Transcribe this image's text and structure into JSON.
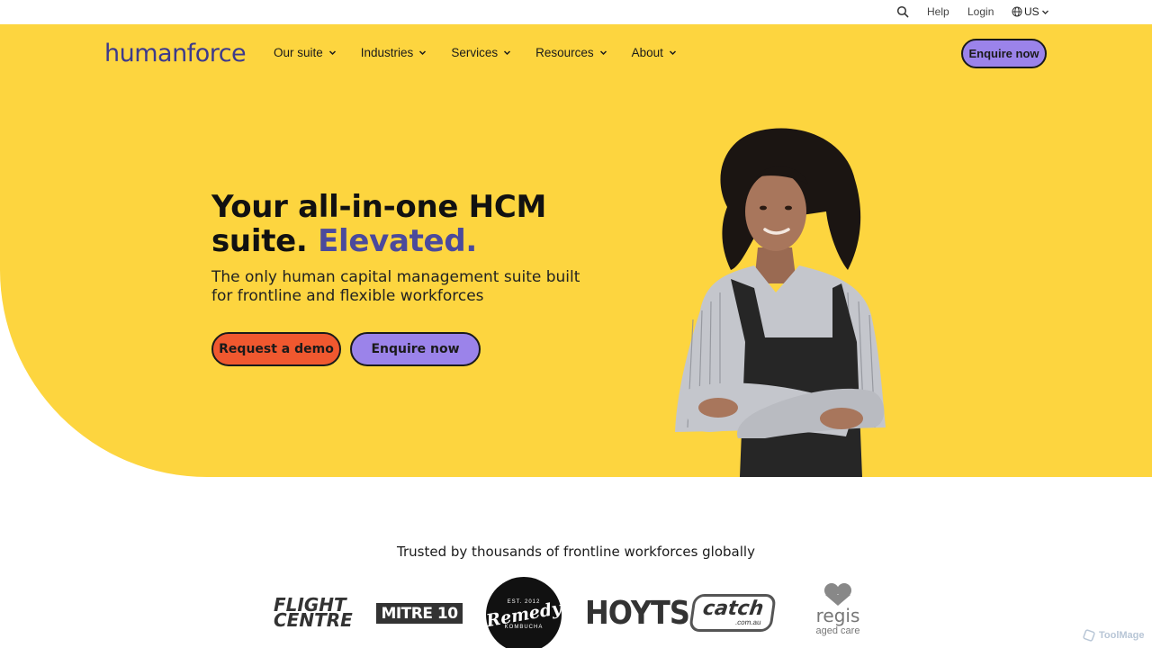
{
  "utility": {
    "help": "Help",
    "login": "Login",
    "locale": "US"
  },
  "header": {
    "logo": "humanforce",
    "nav": [
      {
        "label": "Our suite"
      },
      {
        "label": "Industries"
      },
      {
        "label": "Services"
      },
      {
        "label": "Resources"
      },
      {
        "label": "About"
      }
    ],
    "cta": "Enquire now"
  },
  "hero": {
    "headline_line1": "Your all-in-one HCM",
    "headline_line2_plain": "suite. ",
    "headline_line2_accent": "Elevated.",
    "subhead": "The only human capital management suite built for frontline and flexible workforces",
    "primary_button": "Request a demo",
    "secondary_button": "Enquire now"
  },
  "trusted": {
    "heading": "Trusted by thousands of frontline workforces globally",
    "logos": [
      {
        "name": "flight-centre",
        "line1": "FLIGHT",
        "line2": "CENTRE"
      },
      {
        "name": "mitre-10",
        "text": "MITRE 10"
      },
      {
        "name": "remedy-kombucha",
        "text": "Remedy",
        "sub": "KOMBUCHA",
        "top": "EST. 2012"
      },
      {
        "name": "hoyts",
        "text": "HOYTS"
      },
      {
        "name": "catch",
        "text": "catch",
        "sub": ".com.au"
      },
      {
        "name": "regis",
        "text": "regis",
        "sub": "aged care"
      }
    ]
  },
  "watermark": "ToolMage",
  "colors": {
    "yellow": "#fdd53f",
    "purple": "#9b83ea",
    "orange": "#f0582f",
    "accent_text": "#4b4a9c"
  }
}
